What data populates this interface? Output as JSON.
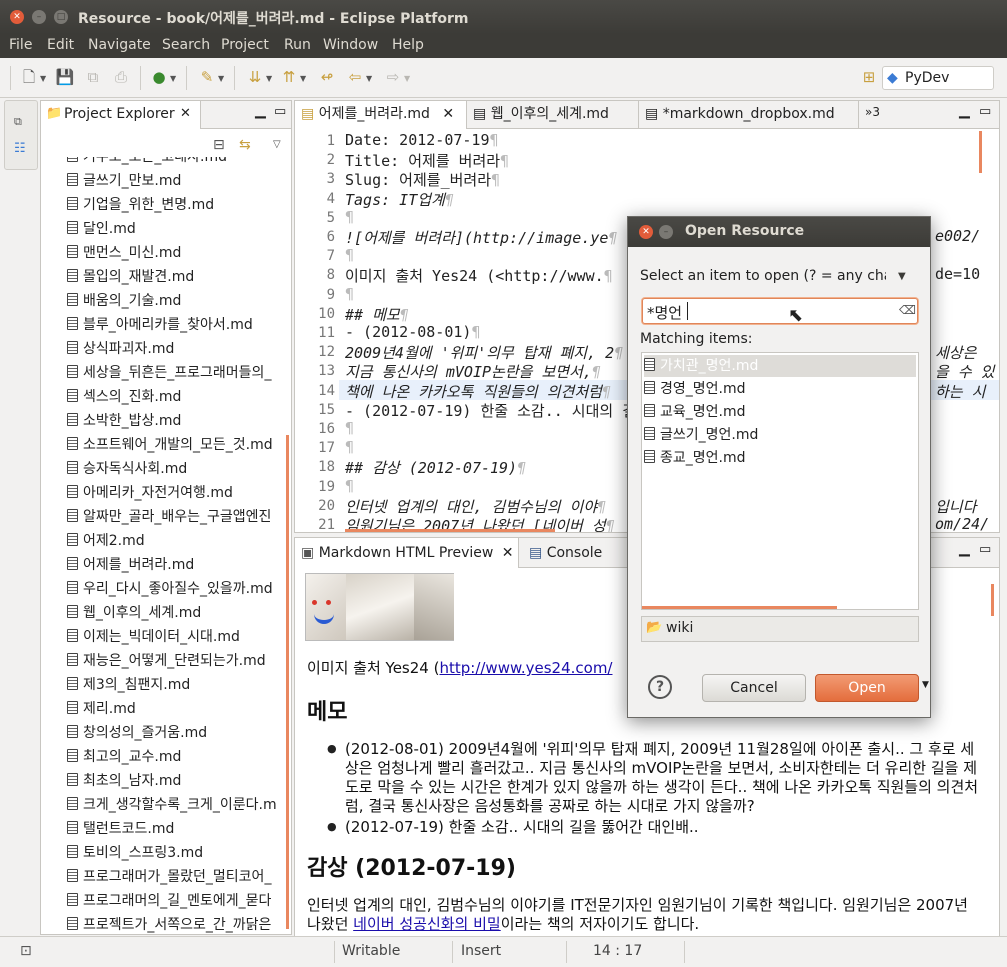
{
  "window": {
    "title": "Resource - book/어제를_버려라.md - Eclipse Platform"
  },
  "menu": [
    "File",
    "Edit",
    "Navigate",
    "Search",
    "Project",
    "Run",
    "Window",
    "Help"
  ],
  "perspective": {
    "label": "PyDev"
  },
  "explorer": {
    "title": "Project Explorer",
    "files": [
      "거두도_모든_고대자.md",
      "글쓰기_만보.md",
      "기업을_위한_변명.md",
      "달인.md",
      "맨먼스_미신.md",
      "몰입의_재발견.md",
      "배움의_기술.md",
      "블루_아메리카를_찾아서.md",
      "상식파괴자.md",
      "세상을_뒤흔든_프로그래머들의_",
      "섹스의_진화.md",
      "소박한_밥상.md",
      "소프트웨어_개발의_모든_것.md",
      "승자독식사회.md",
      "아메리카_자전거여행.md",
      "알짜만_골라_배우는_구글앱엔진",
      "어제2.md",
      "어제를_버려라.md",
      "우리_다시_좋아질수_있을까.md",
      "웹_이후의_세계.md",
      "이제는_빅데이터_시대.md",
      "재능은_어떻게_단련되는가.md",
      "제3의_침팬지.md",
      "제리.md",
      "창의성의_즐거움.md",
      "최고의_교수.md",
      "최초의_남자.md",
      "크게_생각할수록_크게_이룬다.m",
      "탤런트코드.md",
      "토비의_스프링3.md",
      "프로그래머가_몰랐던_멀티코어_",
      "프로그래머의_길_멘토에게_묻다",
      "프로젝트가_서쪽으로_간_까닭은"
    ]
  },
  "editor": {
    "tabs": [
      "어제를_버려라.md",
      "웹_이후의_세계.md",
      "*markdown_dropbox.md"
    ],
    "overflow": "»3",
    "lines": [
      {
        "n": "1",
        "t": "Date: 2012-07-19",
        "style": "plain"
      },
      {
        "n": "2",
        "t": "Title: 어제를 버려라",
        "style": "plain"
      },
      {
        "n": "3",
        "t": "Slug: 어제를_버려라",
        "style": "plain"
      },
      {
        "n": "4",
        "t": "Tags: IT업계",
        "style": "it"
      },
      {
        "n": "5",
        "t": "",
        "style": "plain"
      },
      {
        "n": "6",
        "t": "![어제를 버려라](http://image.ye",
        "style": "it"
      },
      {
        "n": "7",
        "t": "",
        "style": "plain"
      },
      {
        "n": "8",
        "t": "이미지 출처 Yes24 (<http://www.",
        "style": "plain"
      },
      {
        "n": "9",
        "t": "",
        "style": "plain"
      },
      {
        "n": "10",
        "t": "## 메모",
        "style": "it"
      },
      {
        "n": "11",
        "t": "- (2012-08-01)",
        "style": "plain"
      },
      {
        "n": "12",
        "t": "2009년4월에 '위피'의무 탑재 폐지, 2",
        "style": "it"
      },
      {
        "n": "13",
        "t": "지금 통신사의 mVOIP논란을 보면서,",
        "style": "it"
      },
      {
        "n": "14",
        "t": "책에 나온 카카오톡 직원들의 의견처럼",
        "style": "it"
      },
      {
        "n": "15",
        "t": "- (2012-07-19) 한줄 소감.. 시대의 길",
        "style": "plain"
      },
      {
        "n": "16",
        "t": "",
        "style": "plain"
      },
      {
        "n": "17",
        "t": "",
        "style": "plain"
      },
      {
        "n": "18",
        "t": "## 감상 (2012-07-19)",
        "style": "it"
      },
      {
        "n": "19",
        "t": "",
        "style": "plain"
      },
      {
        "n": "20",
        "t": "인터넷 업계의 대인, 김범수님의 이야",
        "style": "it"
      },
      {
        "n": "21",
        "t": "임원기님은 2007년 나왔던 [네이버 성",
        "style": "it"
      }
    ],
    "right_fragments": {
      "l6": "e002/",
      "l8": "de=10",
      "l12": "세상은",
      "l13": "을 수 있",
      "l14": "하는 시",
      "l20": "입니다",
      "l21": "om/24/"
    }
  },
  "preview": {
    "tabs": [
      "Markdown HTML Preview",
      "Console"
    ],
    "image_credit_prefix": "이미지 출처 Yes24 (",
    "image_credit_link": "http://www.yes24.com/",
    "h_memo": "메모",
    "bullets": [
      "(2012-08-01) 2009년4월에 '위피'의무 탑재 폐지, 2009년 11월28일에 아이폰 출시.. 그 후로 세상은 엄청나게 빨리 흘러갔고.. 지금 통신사의 mVOIP논란을 보면서, 소비자한테는 더 유리한 길을 제도로 막을 수 있는 시간은 한계가 있지 않을까 하는 생각이 든다.. 책에 나온 카카오톡 직원들의 의견처럼, 결국 통신사장은 음성통화를 공짜로 하는 시대로 가지 않을까?",
      "(2012-07-19) 한줄 소감.. 시대의 길을 뚫어간 대인배.."
    ],
    "h_review": "감상 (2012-07-19)",
    "para_prefix": "인터넷 업계의 대인, 김범수님의 이야기를 IT전문기자인 임원기님이 기록한 책입니다. 임원기님은 2007년 나왔던 ",
    "para_link": "네이버 성공신화의 비밀",
    "para_suffix": "이라는 책의 저자이기도 합니다."
  },
  "status": {
    "mode": "Writable",
    "insert": "Insert",
    "position": "14 : 17"
  },
  "dialog": {
    "title": "Open Resource",
    "prompt": "Select an item to open (? = any charac",
    "query": "*명언",
    "matching_label": "Matching items:",
    "items": [
      "가치관_명언.md",
      "경영_명언.md",
      "교육_명언.md",
      "글쓰기_명언.md",
      "종교_명언.md"
    ],
    "selected_index": 0,
    "folder": "wiki",
    "cancel": "Cancel",
    "open": "Open",
    "help": "?"
  },
  "colors": {
    "accent": "#e9875f",
    "titlebar": "#3c3b37",
    "link": "#1a0dab"
  }
}
